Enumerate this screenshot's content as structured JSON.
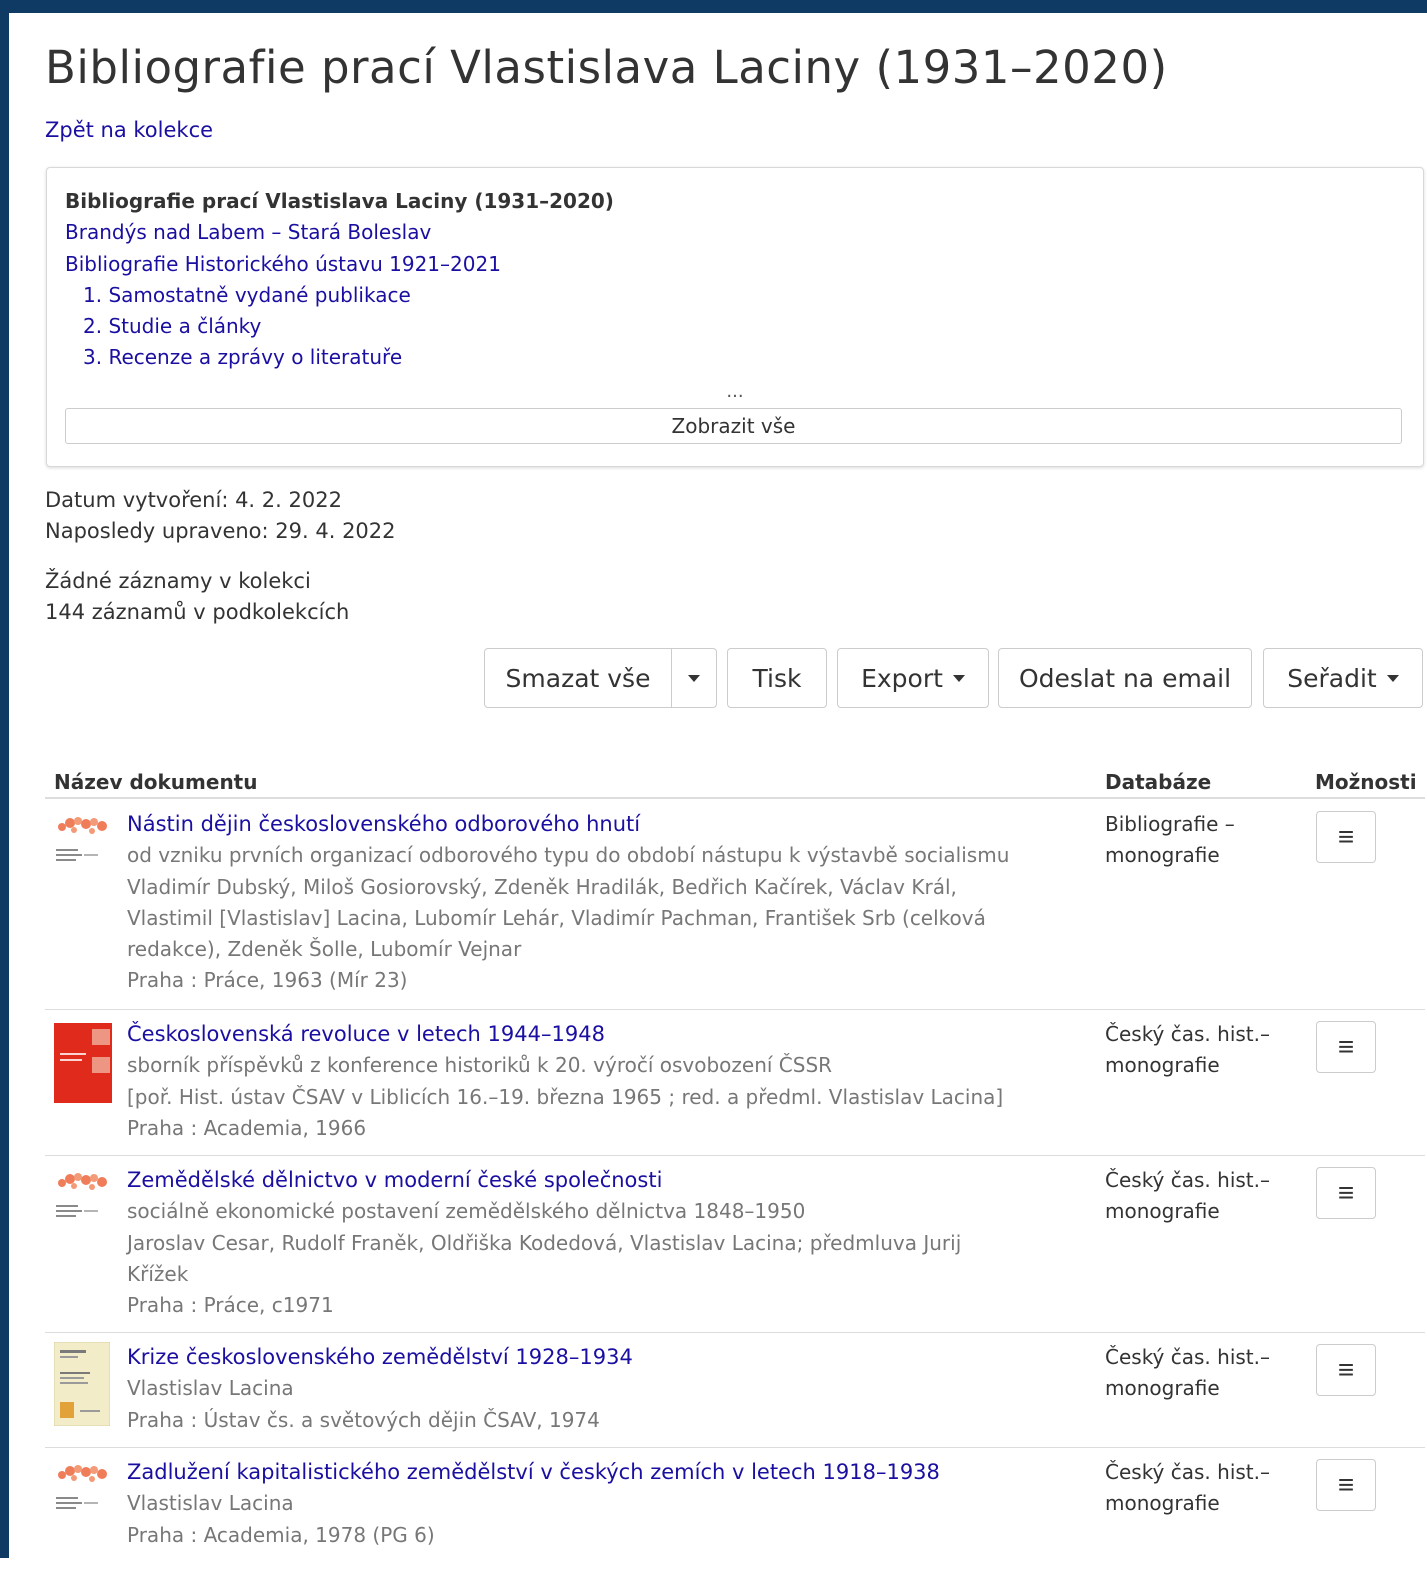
{
  "page": {
    "title": "Bibliografie prací Vlastislava Laciny (1931–2020)",
    "back_link": "Zpět na kolekce"
  },
  "tree": {
    "current": "Bibliografie prací Vlastislava Laciny (1931–2020)",
    "parents": [
      "Brandýs nad Labem – Stará Boleslav",
      "Bibliografie Historického ústavu 1921–2021"
    ],
    "children": [
      {
        "num": "1.",
        "label": "Samostatně vydané publikace"
      },
      {
        "num": "2.",
        "label": "Studie a články"
      },
      {
        "num": "3.",
        "label": "Recenze a zprávy o literatuře"
      }
    ],
    "ellipsis": "...",
    "show_all": "Zobrazit vše"
  },
  "meta": {
    "created": "Datum vytvoření: 4. 2. 2022",
    "modified": "Naposledy upraveno: 29. 4. 2022",
    "no_records": "Žádné záznamy v kolekci",
    "subrecords": "144 záznamů v podkolekcích"
  },
  "toolbar": {
    "delete_all": "Smazat vše",
    "print": "Tisk",
    "export": "Export",
    "email": "Odeslat na email",
    "sort": "Seřadit"
  },
  "table": {
    "col_title": "Název dokumentu",
    "col_db": "Databáze",
    "col_options": "Možnosti",
    "menu_glyph": "≡",
    "rows": [
      {
        "title": "Nástin dějin československého odborového hnutí",
        "lines": [
          "od vzniku prvních organizací odborového typu do období nástupu k výstavbě socialismu",
          "Vladimír Dubský, Miloš Gosiorovský, Zdeněk Hradilák, Bedřich Kačírek, Václav Král,",
          "Vlastimil [Vlastislav] Lacina, Lubomír Lehár, Vladimír Pachman, František Srb (celková",
          "redakce), Zdeněk Šolle, Lubomír Vejnar",
          "Praha : Práce, 1963 (Mír 23)"
        ],
        "db": [
          "Bibliografie –",
          "monografie"
        ],
        "thumb": "logo-icon"
      },
      {
        "title": "Československá revoluce v letech 1944–1948",
        "lines": [
          "sborník příspěvků z konference historiků k 20. výročí osvobození ČSSR",
          "[poř. Hist. ústav ČSAV v Liblicích 16.–19. března 1965 ; red. a předml. Vlastislav Lacina]",
          "Praha : Academia, 1966"
        ],
        "db": [
          "Český čas. hist.–",
          "monografie"
        ],
        "thumb": "red-cover"
      },
      {
        "title": "Zemědělské dělnictvo v moderní české společnosti",
        "lines": [
          "sociálně ekonomické postavení zemědělského dělnictva 1848–1950",
          "Jaroslav Cesar, Rudolf Franěk, Oldřiška Kodedová, Vlastislav Lacina; předmluva Jurij",
          "Křížek",
          "Praha : Práce, c1971"
        ],
        "db": [
          "Český čas. hist.–",
          "monografie"
        ],
        "thumb": "logo-icon"
      },
      {
        "title": "Krize československého zemědělství 1928–1934",
        "lines": [
          "Vlastislav Lacina",
          "Praha : Ústav čs. a světových dějin ČSAV, 1974"
        ],
        "db": [
          "Český čas. hist.–",
          "monografie"
        ],
        "thumb": "yellow-cover"
      },
      {
        "title": "Zadlužení kapitalistického zemědělství v českých zemích v letech 1918–1938",
        "lines": [
          "Vlastislav Lacina",
          "Praha : Academia, 1978 (PG 6)"
        ],
        "db": [
          "Český čas. hist.–",
          "monografie"
        ],
        "thumb": "logo-icon"
      }
    ]
  },
  "colors": {
    "frame": "#0f3a63",
    "link": "#1a0fa0",
    "muted": "#777777",
    "red_cover": "#e02a1b"
  }
}
